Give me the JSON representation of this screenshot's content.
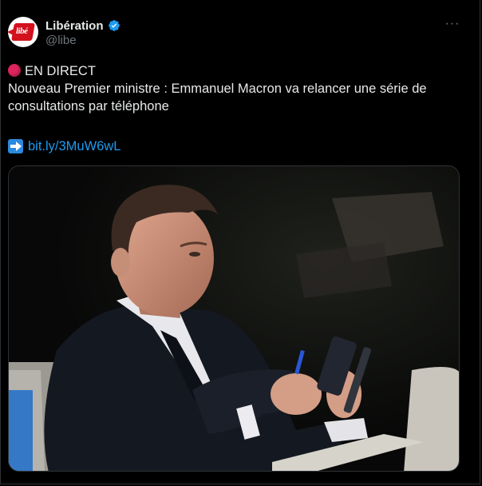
{
  "author": {
    "display_name": "Libération",
    "handle": "@libe",
    "avatar_text": "libé",
    "verified_icon": "verified-badge-icon",
    "verified_color": "#1d9bf0"
  },
  "menu": {
    "more_label": "···"
  },
  "tweet": {
    "line1": "EN DIRECT",
    "line2": " Nouveau Premier ministre : Emmanuel Macron va relancer une série de",
    "line3": "consultations par téléphone",
    "link_text": "bit.ly/3MuW6wL",
    "live_icon": "red-circle-icon",
    "link_icon": "right-arrow-icon"
  },
  "media": {
    "description_icon": "photo",
    "link_color": "#1d9bf0"
  }
}
